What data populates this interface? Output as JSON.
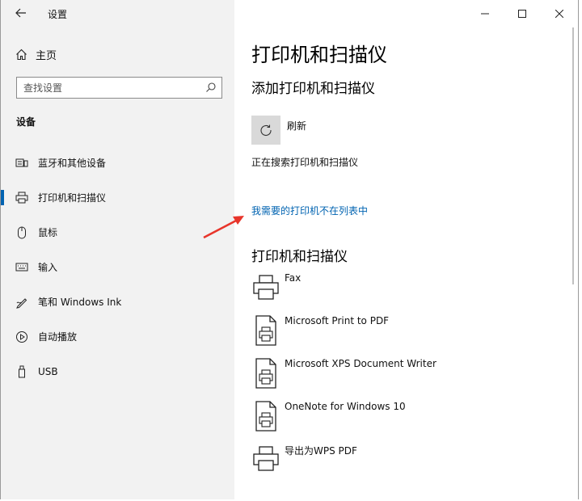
{
  "window": {
    "title": "设置",
    "back_icon": "back-arrow-icon",
    "controls": [
      "minimize-icon",
      "maximize-icon",
      "close-icon"
    ]
  },
  "sidebar": {
    "home_label": "主页",
    "search_placeholder": "查找设置",
    "section": "设备",
    "items": [
      {
        "label": "蓝牙和其他设备",
        "icon": "bluetooth-devices-icon"
      },
      {
        "label": "打印机和扫描仪",
        "icon": "printer-icon",
        "active": true
      },
      {
        "label": "鼠标",
        "icon": "mouse-icon"
      },
      {
        "label": "输入",
        "icon": "keyboard-icon"
      },
      {
        "label": "笔和 Windows Ink",
        "icon": "pen-icon"
      },
      {
        "label": "自动播放",
        "icon": "autoplay-icon"
      },
      {
        "label": "USB",
        "icon": "usb-icon"
      }
    ]
  },
  "main": {
    "title": "打印机和扫描仪",
    "add_section": "添加打印机和扫描仪",
    "refresh_label": "刷新",
    "searching": "正在搜索打印机和扫描仪",
    "missing_link": "我需要的打印机不在列表中",
    "list_section": "打印机和扫描仪",
    "devices": [
      {
        "name": "Fax",
        "icon": "printer-icon"
      },
      {
        "name": "Microsoft Print to PDF",
        "icon": "printer-doc-icon"
      },
      {
        "name": "Microsoft XPS Document Writer",
        "icon": "printer-doc-icon"
      },
      {
        "name": "OneNote for Windows 10",
        "icon": "printer-doc-icon"
      },
      {
        "name": "导出为WPS PDF",
        "icon": "printer-icon"
      }
    ]
  },
  "colors": {
    "accent": "#0063b1",
    "sidebar_bg": "#f2f2f2",
    "annotation_arrow": "#e8352b"
  }
}
